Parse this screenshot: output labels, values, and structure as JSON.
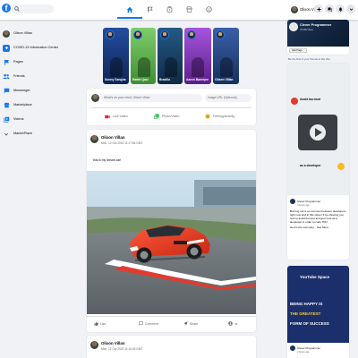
{
  "header": {
    "logo_letter": "f",
    "search_icon": "search-icon",
    "nav_icons": [
      "home-icon",
      "flag-icon",
      "subscriptions-icon",
      "storefront-icon",
      "supervised-user-icon"
    ],
    "active_nav": "home-icon",
    "user_name": "Olixon Villan",
    "action_icons": [
      "add-icon",
      "forum-icon",
      "notifications-icon",
      "expand-more-icon"
    ],
    "brand_color": "#1877f2"
  },
  "sidebar": {
    "items": [
      {
        "label": "Olixon Villan",
        "icon": "avatar"
      },
      {
        "label": "COVID-19 Information Center",
        "icon": "local-hospital-icon",
        "color": "#1877f2"
      },
      {
        "label": "Pages",
        "icon": "emoji-flags-icon",
        "color": "#1877f2"
      },
      {
        "label": "Friends",
        "icon": "people-icon",
        "color": "#1877f2"
      },
      {
        "label": "Messenger",
        "icon": "chat-icon",
        "color": "#1877f2"
      },
      {
        "label": "Marketplace",
        "icon": "storefront-icon",
        "color": "#1877f2"
      },
      {
        "label": "Videos",
        "icon": "video-library-icon",
        "color": "#1877f2"
      },
      {
        "label": "MarketPlace",
        "icon": "expand-more-icon",
        "color": "#65676b"
      }
    ]
  },
  "stories": [
    {
      "name": "Sonny Sangha",
      "bg": "#1c3f8f"
    },
    {
      "name": "Rafeh Qazi",
      "bg": "#6bbf59"
    },
    {
      "name": "Brazilio",
      "bg": "#1e4a6e"
    },
    {
      "name": "Aaron Banerjee",
      "bg": "#8d3dc4"
    },
    {
      "name": "Olixon Villan",
      "bg": "#2b4a8b"
    }
  ],
  "composer": {
    "placeholder": "What's on your mind, Olixon Villan",
    "url_placeholder": "image URL (Optional)",
    "actions": [
      {
        "label": "Live Video",
        "icon": "videocam-icon",
        "color": "#e42645"
      },
      {
        "label": "Photo/Video",
        "icon": "photo-library-icon",
        "color": "#45bd62"
      },
      {
        "label": "Feeling/Activity",
        "icon": "insert-emoticon-icon",
        "color": "#f7b928"
      }
    ]
  },
  "post": {
    "author": "Olixon Villan",
    "timestamp": "Mon, 12 Oct 2020 11:17:56 GMT",
    "message": "this is my dream car!",
    "actions": [
      {
        "label": "Like",
        "icon": "thumb-up-icon"
      },
      {
        "label": "Comment",
        "icon": "chat-bubble-outline-icon"
      },
      {
        "label": "Share",
        "icon": "near-me-icon"
      },
      {
        "label": "",
        "icon": "account-circle-icon"
      }
    ]
  },
  "post2": {
    "author": "Olixon Villan",
    "timestamp": "Mon, 12 Oct 2020 11:16:49 GMT"
  },
  "widget": {
    "page_name": "Clever Programmer",
    "followers": "79,902 likes",
    "like_label": "Like Page",
    "cta": "Be the first of your friends to like this"
  },
  "ad1": {
    "top_caption": "Avoid burnout",
    "bottom_caption": "as a developer",
    "page_name": "Clever Programmer",
    "sub": "4 hours ago",
    "body": "Burning out is so common between developers right now and in this video I'll be showing you how to avoid burnout and get more as a developer in order to code TMJ.",
    "body_2": "Here's the summary... See More"
  },
  "ad2": {
    "line1": "BEING HAPPY IS",
    "line2": "THE GREATEST",
    "line3": "FORM OF SUCCESS",
    "badge": "YouTube Space",
    "page_name": "Clever Programmer",
    "sub": "2 hours ago"
  }
}
